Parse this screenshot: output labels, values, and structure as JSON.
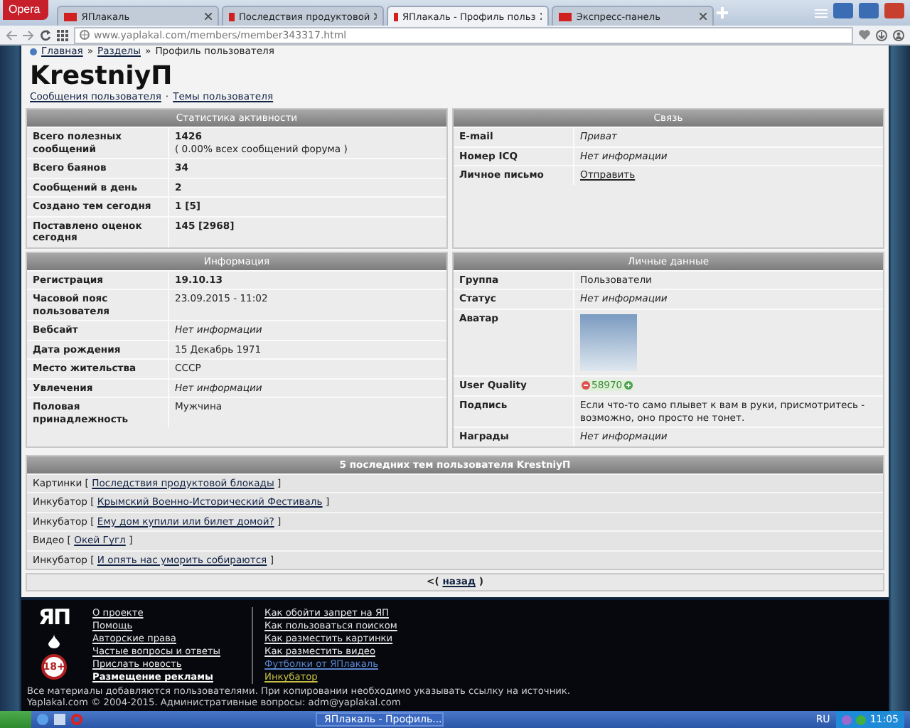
{
  "browser": {
    "menu_button": "Opera",
    "tabs": [
      {
        "title": "ЯПлакаль",
        "selected": false
      },
      {
        "title": "Последствия продуктовой",
        "selected": false
      },
      {
        "title": "ЯПлакаль - Профиль польз",
        "selected": true
      },
      {
        "title": "Экспресс-панель",
        "selected": false
      }
    ],
    "address": "www.yaplakal.com/members/member343317.html"
  },
  "breadcrumb": [
    "Главная",
    "»",
    "Разделы",
    "»",
    "Профиль пользователя"
  ],
  "profile": {
    "username": "KrestniyП",
    "links": [
      "Сообщения пользователя",
      "·",
      "Темы пользователя"
    ]
  },
  "sections": [
    {
      "title": "Статистика активности",
      "rows": [
        {
          "label": "Всего полезных сообщений",
          "kind": "bold",
          "value": "1426",
          "note": "( 0.00% всех сообщений форума )"
        },
        {
          "label": "Всего баянов",
          "kind": "bold",
          "value": "34"
        },
        {
          "label": "Сообщений в день",
          "kind": "bold",
          "value": "2"
        },
        {
          "label": "Создано тем сегодня",
          "kind": "bold",
          "value": "1 [5]"
        },
        {
          "label": "Поставлено оценок сегодня",
          "kind": "bold",
          "value": "145 [2968]"
        }
      ]
    },
    {
      "title": "Связь",
      "rows": [
        {
          "label": "E-mail",
          "kind": "italic",
          "value": "Приват"
        },
        {
          "label": "Номер ICQ",
          "kind": "italic",
          "value": "Нет информации"
        },
        {
          "label": "Личное письмо",
          "kind": "link",
          "value": "Отправить"
        }
      ]
    },
    {
      "title": "Информация",
      "rows": [
        {
          "label": "Регистрация",
          "kind": "bold",
          "value": "19.10.13"
        },
        {
          "label": "Часовой пояс пользователя",
          "kind": "plain",
          "value": "23.09.2015 - 11:02"
        },
        {
          "label": "Вебсайт",
          "kind": "italic",
          "value": "Нет информации"
        },
        {
          "label": "Дата рождения",
          "kind": "plain",
          "value": "15 Декабрь 1971"
        },
        {
          "label": "Место жительства",
          "kind": "plain",
          "value": "СССР"
        },
        {
          "label": "Увлечения",
          "kind": "italic",
          "value": "Нет информации"
        },
        {
          "label": "Половая принадлежность",
          "kind": "plain",
          "value": "Мужчина"
        }
      ]
    },
    {
      "title": "Личные данные",
      "rows": [
        {
          "label": "Группа",
          "kind": "plain",
          "value": "Пользователи"
        },
        {
          "label": "Статус",
          "kind": "italic",
          "value": "Нет информации"
        },
        {
          "label": "Аватар",
          "kind": "avatar"
        },
        {
          "label": "User Quality",
          "kind": "rating",
          "value": "58970"
        },
        {
          "label": "Подпись",
          "kind": "plain",
          "value": "Если что-то само плывет к вам в руки, присмотритесь - возможно, оно просто не тонет."
        },
        {
          "label": "Награды",
          "kind": "italic",
          "value": "Нет информации"
        }
      ]
    }
  ],
  "topics": {
    "title": "5 последних тем пользователя KrestniyП",
    "rows": [
      {
        "prefix": "Картинки [",
        "title": "Последствия продуктовой блокады",
        "suffix": "]"
      },
      {
        "prefix": "Инкубатор [",
        "title": "Крымский Военно-Исторический Фестиваль",
        "suffix": "]"
      },
      {
        "prefix": "Инкубатор [",
        "title": "Ему дом купили или билет домой?",
        "suffix": "]"
      },
      {
        "prefix": "Видео [",
        "title": "Окей Гугл",
        "suffix": "]"
      },
      {
        "prefix": "Инкубатор [",
        "title": "И опять нас уморить собираются",
        "suffix": "]"
      }
    ]
  },
  "back": {
    "prefix": "<(",
    "link": "назад",
    "suffix": ")"
  },
  "footer": {
    "logo": "ЯП",
    "age_badge": "18+",
    "links_left": [
      {
        "text": "О проекте",
        "bold": false
      },
      {
        "text": "Помощь",
        "bold": false
      },
      {
        "text": "Авторские права",
        "bold": false
      },
      {
        "text": "Частые вопросы и ответы",
        "bold": false
      },
      {
        "text": "Прислать новость",
        "bold": false
      },
      {
        "text": "Размещение рекламы",
        "bold": true
      }
    ],
    "links_right": [
      {
        "text": "Как обойти запрет на ЯП",
        "color": "#e8e8e8"
      },
      {
        "text": "Как пользоваться поиском",
        "color": "#e8e8e8"
      },
      {
        "text": "Как разместить картинки",
        "color": "#e8e8e8"
      },
      {
        "text": "Как разместить видео",
        "color": "#e8e8e8"
      },
      {
        "text": "Футболки от ЯПлакаль",
        "color": "#5b86d0"
      },
      {
        "text": "Инкубатор",
        "color": "#c8c040"
      }
    ],
    "notice": "Все материалы добавляются пользователями. При копировании необходимо указывать ссылку на источник.",
    "copyright": "Yaplakal.com © 2004-2015. Административные вопросы: adm@yaplakal.com"
  },
  "taskbar": {
    "task": "ЯПлакаль - Профиль...",
    "language": "RU",
    "time": "11:05"
  }
}
